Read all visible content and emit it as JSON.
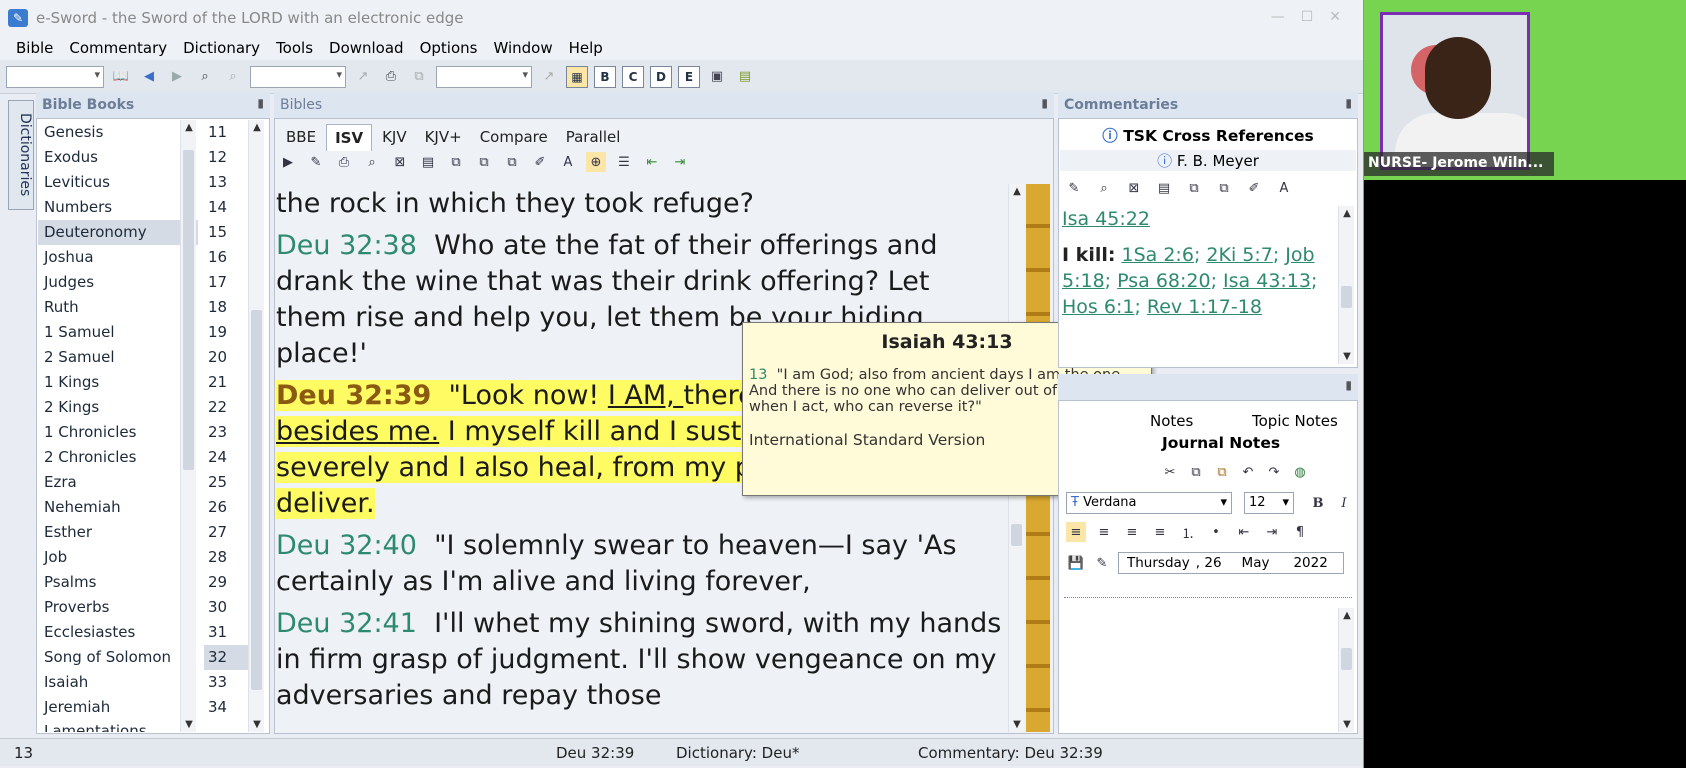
{
  "window": {
    "title": "e-Sword - the Sword of the LORD with an electronic edge"
  },
  "menu": [
    "Bible",
    "Commentary",
    "Dictionary",
    "Tools",
    "Download",
    "Options",
    "Window",
    "Help"
  ],
  "sidebar_tab": "Dictionaries",
  "bible_books_pane": {
    "title": "Bible Books",
    "books": [
      "Genesis",
      "Exodus",
      "Leviticus",
      "Numbers",
      "Deuteronomy",
      "Joshua",
      "Judges",
      "Ruth",
      "1 Samuel",
      "2 Samuel",
      "1 Kings",
      "2 Kings",
      "1 Chronicles",
      "2 Chronicles",
      "Ezra",
      "Nehemiah",
      "Esther",
      "Job",
      "Psalms",
      "Proverbs",
      "Ecclesiastes",
      "Song of Solomon",
      "Isaiah",
      "Jeremiah",
      "Lamentations"
    ],
    "selected_book": "Deuteronomy",
    "chapters": [
      "11",
      "12",
      "13",
      "14",
      "15",
      "16",
      "17",
      "18",
      "19",
      "20",
      "21",
      "22",
      "23",
      "24",
      "25",
      "26",
      "27",
      "28",
      "29",
      "30",
      "31",
      "32",
      "33",
      "34"
    ],
    "selected_chapter": "32"
  },
  "bibles_pane": {
    "title": "Bibles",
    "tabs": [
      "BBE",
      "ISV",
      "KJV",
      "KJV+",
      "Compare",
      "Parallel"
    ],
    "active_tab": "ISV",
    "verses": [
      {
        "ref": "",
        "text": "the rock in which they took refuge?"
      },
      {
        "ref": "Deu 32:38",
        "text": "Who ate the fat of their offerings and drank the wine that was their drink offering? Let them rise and help you, let them be your hiding place!'"
      },
      {
        "ref": "Deu 32:39",
        "text_a": "\"Look now! ",
        "text_u1": "I AM, ",
        "text_b": "there is no ",
        "text_u2": "other god besides me.",
        "text_c": " I myself kill and I sustain life; I wound severely and I also heal, from my power no one can deliver."
      },
      {
        "ref": "Deu 32:40",
        "text": "\"I solemnly swear to heaven—I say 'As certainly as I'm alive and living forever,"
      },
      {
        "ref": "Deu 32:41",
        "text": "I'll whet my shining sword, with my hands in firm grasp of judgment. I'll show vengeance on my adversaries and repay those"
      }
    ]
  },
  "tooltip": {
    "title": "Isaiah 43:13",
    "verse_num": "13",
    "text": "\"I am God; also from ancient days I am the one. And there is no one who can deliver out of my hand; when I act, who can reverse it?\"",
    "version": "International Standard Version"
  },
  "commentaries_pane": {
    "title": "Commentaries",
    "tab1": "TSK Cross References",
    "tab2": "F. B. Meyer",
    "refs_top": "Isa 45:22",
    "kill_label": "I kill:",
    "kill_refs": [
      "1Sa 2:6",
      "2Ki 5:7",
      "Job 5:18",
      "Psa 68:20",
      "Isa 43:13",
      "Hos 6:1",
      "Rev 1:17-18"
    ]
  },
  "notes_pane": {
    "tab_notes": "Notes",
    "tab_topic": "Topic Notes",
    "tab_journal": "Journal Notes",
    "font": "Verdana",
    "size": "12",
    "day": "Thursday",
    "date_num": ", 26",
    "month": "May",
    "year": "2022"
  },
  "status": {
    "left": "13",
    "bible": "Deu 32:39",
    "dictionary": "Dictionary: Deu*",
    "commentary": "Commentary: Deu 32:39"
  },
  "video": {
    "name": "NURSE- Jerome Wiln..."
  }
}
